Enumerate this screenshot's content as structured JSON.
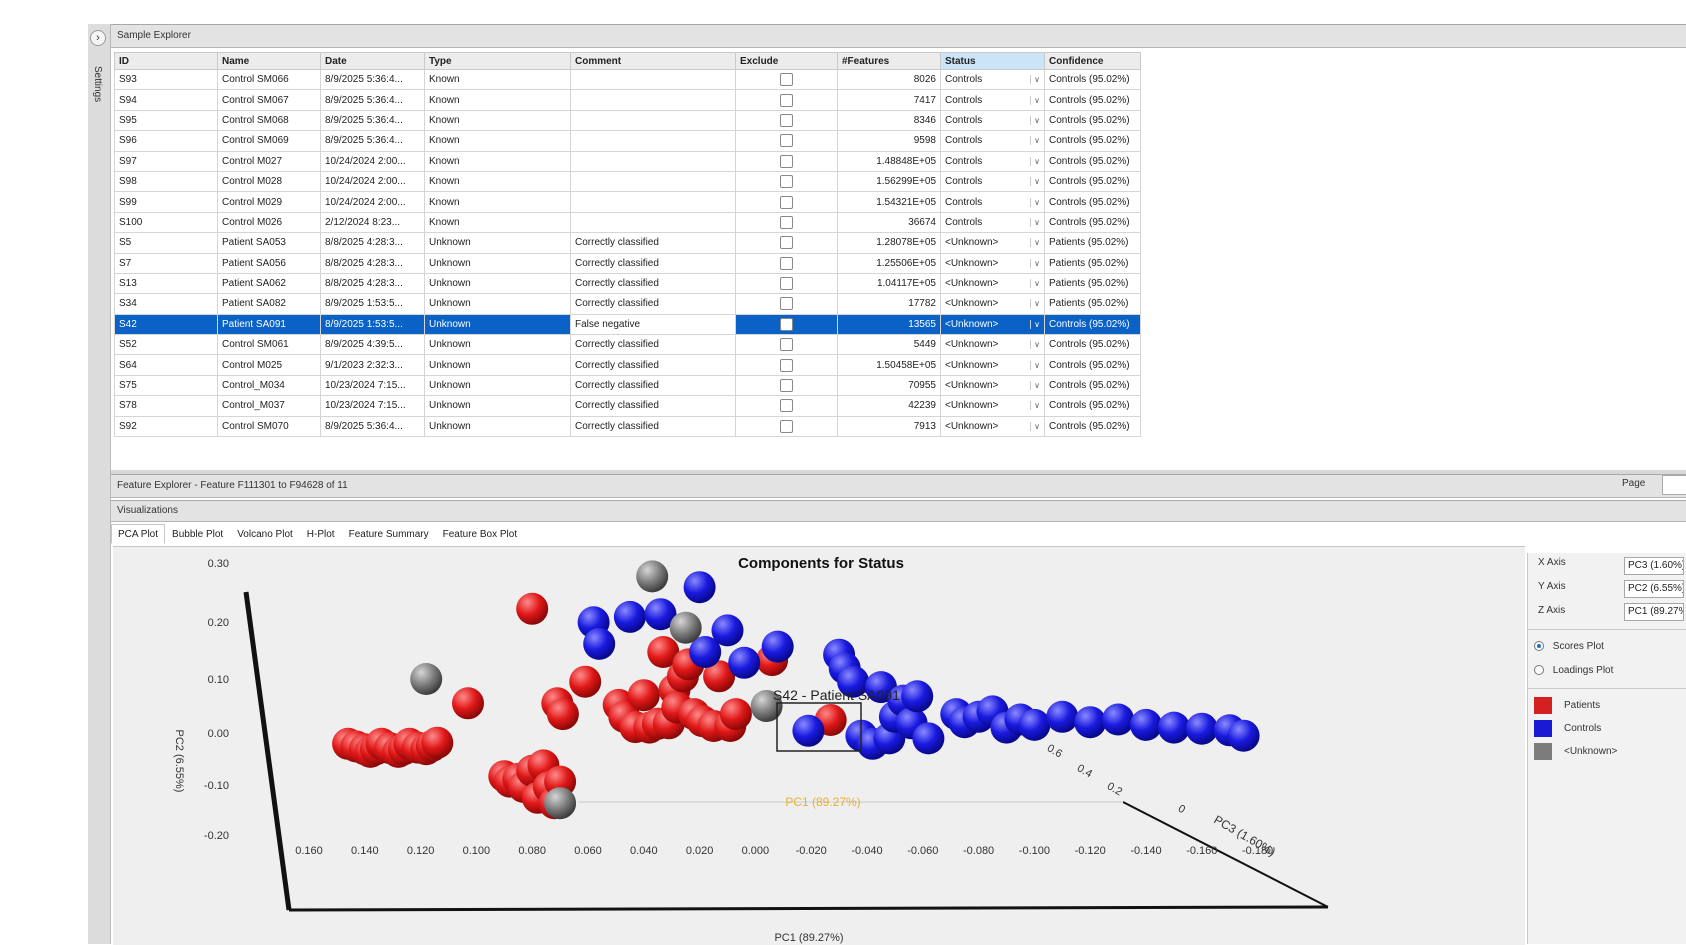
{
  "sidebar": {
    "expand_icon": "chevron-right-icon",
    "expand_glyph": "›",
    "settings_label": "Settings"
  },
  "sample_explorer": {
    "title": "Sample Explorer",
    "columns": [
      "ID",
      "Name",
      "Date",
      "Type",
      "Comment",
      "Exclude",
      "#Features",
      "Status",
      "Confidence"
    ],
    "rows": [
      {
        "id": "S93",
        "name": "Control SM066",
        "date": "8/9/2025 5:36:4...",
        "type": "Known",
        "comment": "",
        "features": "8026",
        "status": "Controls",
        "confidence": "Controls (95.02%)"
      },
      {
        "id": "S94",
        "name": "Control SM067",
        "date": "8/9/2025 5:36:4...",
        "type": "Known",
        "comment": "",
        "features": "7417",
        "status": "Controls",
        "confidence": "Controls (95.02%)"
      },
      {
        "id": "S95",
        "name": "Control SM068",
        "date": "8/9/2025 5:36:4...",
        "type": "Known",
        "comment": "",
        "features": "8346",
        "status": "Controls",
        "confidence": "Controls (95.02%)"
      },
      {
        "id": "S96",
        "name": "Control SM069",
        "date": "8/9/2025 5:36:4...",
        "type": "Known",
        "comment": "",
        "features": "9598",
        "status": "Controls",
        "confidence": "Controls (95.02%)"
      },
      {
        "id": "S97",
        "name": "Control M027",
        "date": "10/24/2024 2:00...",
        "type": "Known",
        "comment": "",
        "features": "1.48848E+05",
        "status": "Controls",
        "confidence": "Controls (95.02%)"
      },
      {
        "id": "S98",
        "name": "Control M028",
        "date": "10/24/2024 2:00...",
        "type": "Known",
        "comment": "",
        "features": "1.56299E+05",
        "status": "Controls",
        "confidence": "Controls (95.02%)"
      },
      {
        "id": "S99",
        "name": "Control M029",
        "date": "10/24/2024 2:00...",
        "type": "Known",
        "comment": "",
        "features": "1.54321E+05",
        "status": "Controls",
        "confidence": "Controls (95.02%)"
      },
      {
        "id": "S100",
        "name": "Control M026",
        "date": "2/12/2024 8:23...",
        "type": "Known",
        "comment": "",
        "features": "36674",
        "status": "Controls",
        "confidence": "Controls (95.02%)"
      },
      {
        "id": "S5",
        "name": "Patient SA053",
        "date": "8/8/2025 4:28:3...",
        "type": "Unknown",
        "comment": "Correctly classified",
        "features": "1.28078E+05",
        "status": "<Unknown>",
        "confidence": "Patients (95.02%)"
      },
      {
        "id": "S7",
        "name": "Patient SA056",
        "date": "8/8/2025 4:28:3...",
        "type": "Unknown",
        "comment": "Correctly classified",
        "features": "1.25506E+05",
        "status": "<Unknown>",
        "confidence": "Patients (95.02%)"
      },
      {
        "id": "S13",
        "name": "Patient SA062",
        "date": "8/8/2025 4:28:3...",
        "type": "Unknown",
        "comment": "Correctly classified",
        "features": "1.04117E+05",
        "status": "<Unknown>",
        "confidence": "Patients (95.02%)"
      },
      {
        "id": "S34",
        "name": "Patient SA082",
        "date": "8/9/2025 1:53:5...",
        "type": "Unknown",
        "comment": "Correctly classified",
        "features": "17782",
        "status": "<Unknown>",
        "confidence": "Patients (95.02%)"
      },
      {
        "id": "S42",
        "name": "Patient SA091",
        "date": "8/9/2025 1:53:5...",
        "type": "Unknown",
        "comment": "False negative",
        "features": "13565",
        "status": "<Unknown>",
        "confidence": "Controls (95.02%)",
        "selected": true
      },
      {
        "id": "S52",
        "name": "Control SM061",
        "date": "8/9/2025 4:39:5...",
        "type": "Unknown",
        "comment": "Correctly classified",
        "features": "5449",
        "status": "<Unknown>",
        "confidence": "Controls (95.02%)"
      },
      {
        "id": "S64",
        "name": "Control M025",
        "date": "9/1/2023 2:32:3...",
        "type": "Unknown",
        "comment": "Correctly classified",
        "features": "1.50458E+05",
        "status": "<Unknown>",
        "confidence": "Controls (95.02%)"
      },
      {
        "id": "S75",
        "name": "Control_M034",
        "date": "10/23/2024 7:15...",
        "type": "Unknown",
        "comment": "Correctly classified",
        "features": "70955",
        "status": "<Unknown>",
        "confidence": "Controls (95.02%)"
      },
      {
        "id": "S78",
        "name": "Control_M037",
        "date": "10/23/2024 7:15...",
        "type": "Unknown",
        "comment": "Correctly classified",
        "features": "42239",
        "status": "<Unknown>",
        "confidence": "Controls (95.02%)"
      },
      {
        "id": "S92",
        "name": "Control SM070",
        "date": "8/9/2025 5:36:4...",
        "type": "Unknown",
        "comment": "Correctly classified",
        "features": "7913",
        "status": "<Unknown>",
        "confidence": "Controls (95.02%)"
      }
    ]
  },
  "feature_explorer": {
    "title": "Feature Explorer - Feature F111301 to F94628 of 11",
    "page_label": "Page"
  },
  "visualizations": {
    "title": "Visualizations",
    "tabs": [
      "PCA Plot",
      "Bubble Plot",
      "Volcano Plot",
      "H-Plot",
      "Feature Summary",
      "Feature Box Plot"
    ]
  },
  "chart_data": {
    "type": "scatter",
    "title": "Components for Status",
    "xlabel": "PC1 (89.27%)",
    "ylabel": "PC2 (6.55%)",
    "zlabel": "PC3 (1.60%)",
    "y_ticks": [
      "0.30",
      "0.20",
      "0.10",
      "0.00",
      "-0.10",
      "-0.20"
    ],
    "x_ticks": [
      "0.160",
      "0.140",
      "0.120",
      "0.100",
      "0.080",
      "0.060",
      "0.040",
      "0.020",
      "0.000",
      "-0.020",
      "-0.040",
      "-0.060",
      "-0.080",
      "-0.100",
      "-0.120",
      "-0.140",
      "-0.160",
      "-0.180"
    ],
    "z_ticks": [
      "0.6",
      "0.4",
      "0.2",
      "0"
    ],
    "hover_label": "S42 - Patient SA091",
    "series_colors": {
      "Patients": "#d42020",
      "Controls": "#1a1ad4",
      "<Unknown>": "#7c7c7c"
    },
    "series": [
      {
        "name": "Patients",
        "points": [
          [
            0.146,
            -0.02
          ],
          [
            0.143,
            -0.025
          ],
          [
            0.14,
            -0.03
          ],
          [
            0.138,
            -0.035
          ],
          [
            0.136,
            -0.03
          ],
          [
            0.134,
            -0.02
          ],
          [
            0.131,
            -0.028
          ],
          [
            0.128,
            -0.035
          ],
          [
            0.126,
            -0.03
          ],
          [
            0.124,
            -0.02
          ],
          [
            0.121,
            -0.027
          ],
          [
            0.118,
            -0.03
          ],
          [
            0.116,
            -0.024
          ],
          [
            0.114,
            -0.018
          ],
          [
            0.09,
            -0.08
          ],
          [
            0.088,
            -0.09
          ],
          [
            0.085,
            -0.085
          ],
          [
            0.083,
            -0.1
          ],
          [
            0.08,
            -0.07
          ],
          [
            0.078,
            -0.12
          ],
          [
            0.076,
            -0.06
          ],
          [
            0.074,
            -0.1
          ],
          [
            0.072,
            -0.13
          ],
          [
            0.07,
            -0.09
          ],
          [
            0.103,
            0.055
          ],
          [
            0.08,
            0.23
          ],
          [
            0.071,
            0.055
          ],
          [
            0.069,
            0.035
          ],
          [
            0.061,
            0.095
          ],
          [
            0.049,
            0.052
          ],
          [
            0.047,
            0.03
          ],
          [
            0.043,
            0.011
          ],
          [
            0.04,
            0.07
          ],
          [
            0.038,
            0.01
          ],
          [
            0.035,
            0.017
          ],
          [
            0.033,
            0.15
          ],
          [
            0.031,
            0.018
          ],
          [
            0.029,
            0.08
          ],
          [
            0.028,
            0.047
          ],
          [
            0.026,
            0.105
          ],
          [
            0.024,
            0.127
          ],
          [
            0.022,
            0.035
          ],
          [
            0.019,
            0.022
          ],
          [
            0.015,
            0.013
          ],
          [
            0.013,
            0.105
          ],
          [
            0.009,
            0.013
          ],
          [
            0.007,
            0.035
          ],
          [
            -0.006,
            0.135
          ],
          [
            -0.027,
            0.024
          ]
        ]
      },
      {
        "name": "Controls",
        "points": [
          [
            0.058,
            0.205
          ],
          [
            0.056,
            0.165
          ],
          [
            0.045,
            0.215
          ],
          [
            0.034,
            0.22
          ],
          [
            0.02,
            0.27
          ],
          [
            0.018,
            0.15
          ],
          [
            0.01,
            0.19
          ],
          [
            0.004,
            0.13
          ],
          [
            -0.008,
            0.16
          ],
          [
            -0.019,
            0.004
          ],
          [
            -0.03,
            0.145
          ],
          [
            -0.032,
            0.12
          ],
          [
            -0.035,
            0.095
          ],
          [
            -0.045,
            0.085
          ],
          [
            -0.038,
            -0.005
          ],
          [
            -0.042,
            -0.02
          ],
          [
            -0.048,
            -0.01
          ],
          [
            -0.05,
            0.03
          ],
          [
            -0.053,
            0.06
          ],
          [
            -0.056,
            0.018
          ],
          [
            -0.058,
            0.068
          ],
          [
            -0.062,
            -0.01
          ],
          [
            -0.072,
            0.035
          ],
          [
            -0.075,
            0.02
          ],
          [
            -0.08,
            0.03
          ],
          [
            -0.085,
            0.04
          ],
          [
            -0.09,
            0.01
          ],
          [
            -0.095,
            0.025
          ],
          [
            -0.1,
            0.015
          ],
          [
            -0.11,
            0.03
          ],
          [
            -0.12,
            0.02
          ],
          [
            -0.13,
            0.025
          ],
          [
            -0.14,
            0.015
          ],
          [
            -0.15,
            0.01
          ],
          [
            -0.16,
            0.008
          ],
          [
            -0.17,
            0.005
          ],
          [
            -0.175,
            -0.005
          ]
        ]
      },
      {
        "name": "<Unknown>",
        "points": [
          [
            0.118,
            0.1
          ],
          [
            0.07,
            -0.13
          ],
          [
            0.037,
            0.29
          ],
          [
            0.025,
            0.195
          ],
          [
            -0.004,
            0.05
          ]
        ]
      }
    ]
  },
  "controls": {
    "x_axis_label": "X Axis",
    "x_axis_value": "PC3 (1.60%)",
    "y_axis_label": "Y Axis",
    "y_axis_value": "PC2 (6.55%)",
    "z_axis_label": "Z Axis",
    "z_axis_value": "PC1 (89.27%)",
    "scores_plot_label": "Scores Plot",
    "loadings_plot_label": "Loadings Plot",
    "legend": [
      {
        "label": "Patients",
        "color": "#d42020"
      },
      {
        "label": "Controls",
        "color": "#1a1ad4"
      },
      {
        "label": "<Unknown>",
        "color": "#7c7c7c"
      }
    ]
  }
}
